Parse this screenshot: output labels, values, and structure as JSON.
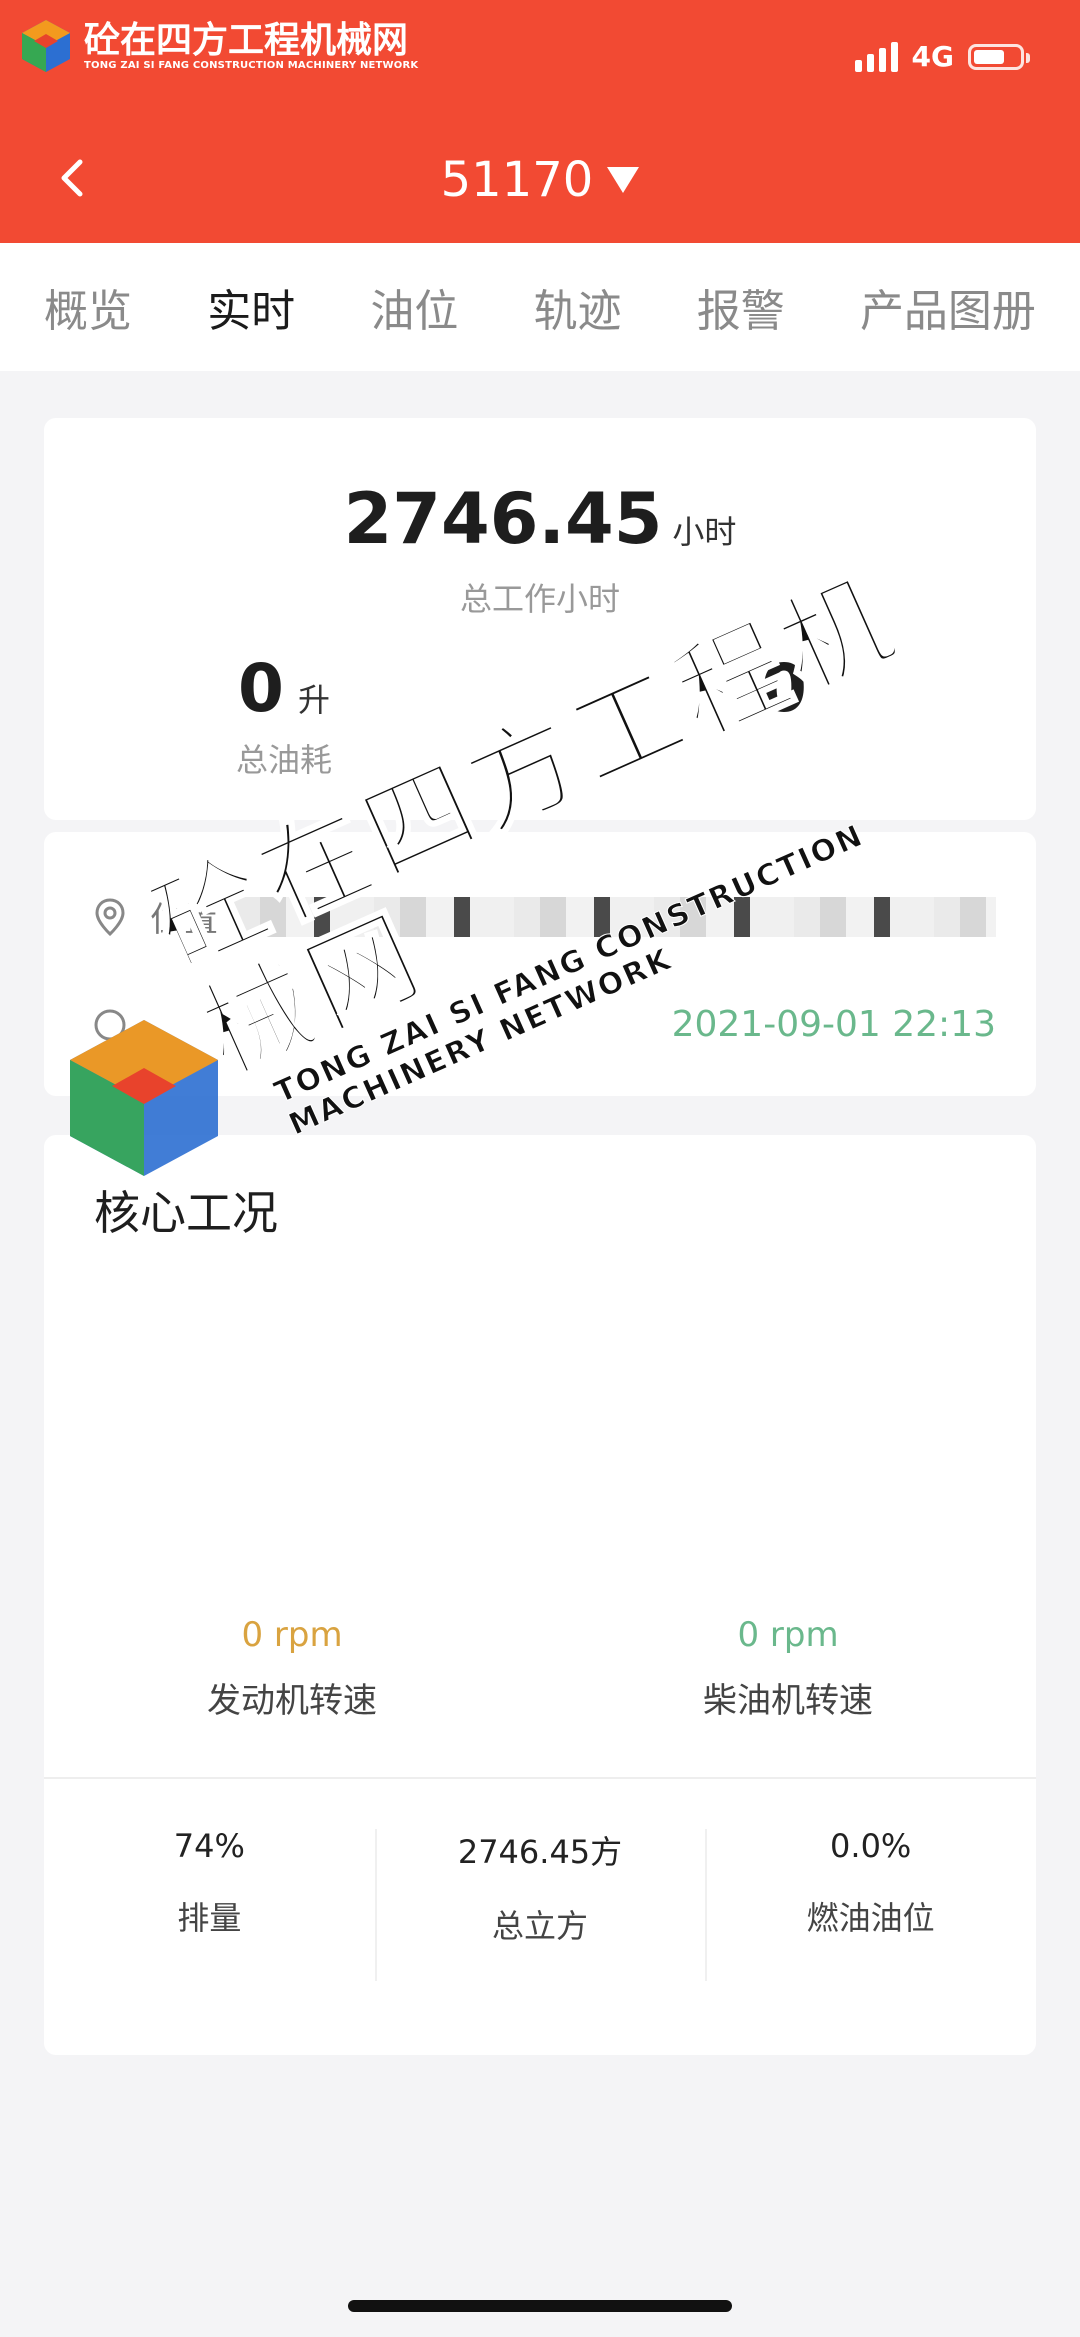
{
  "brand": {
    "name": "砼在四方工程机械网",
    "name_en": "TONG ZAI SI FANG CONSTRUCTION MACHINERY NETWORK",
    "logo_colors": [
      "#f39a1e",
      "#36a852",
      "#2c6fd2",
      "#e8432c"
    ]
  },
  "status_bar": {
    "network": "4G"
  },
  "header": {
    "title": "51170",
    "accent": "#f24a33"
  },
  "tabs": [
    {
      "label": "概览",
      "active": false
    },
    {
      "label": "实时",
      "active": true
    },
    {
      "label": "油位",
      "active": false
    },
    {
      "label": "轨迹",
      "active": false
    },
    {
      "label": "报警",
      "active": false
    },
    {
      "label": "产品图册",
      "active": false
    }
  ],
  "summary": {
    "total_hours_value": "2746.45",
    "total_hours_unit": "小时",
    "total_hours_label": "总工作小时",
    "fuel_value": "0",
    "fuel_unit": "升",
    "fuel_label": "总油耗",
    "power_value": "0"
  },
  "location": {
    "position_label": "位置",
    "time_value": "2021-09-01 22:13"
  },
  "core": {
    "title": "核心工况",
    "engine_speed_value": "0 rpm",
    "engine_speed_label": "发动机转速",
    "diesel_speed_value": "0 rpm",
    "diesel_speed_label": "柴油机转速",
    "stats": [
      {
        "value": "74%",
        "label": "排量"
      },
      {
        "value": "2746.45方",
        "label": "总立方"
      },
      {
        "value": "0.0%",
        "label": "燃油油位"
      }
    ]
  }
}
